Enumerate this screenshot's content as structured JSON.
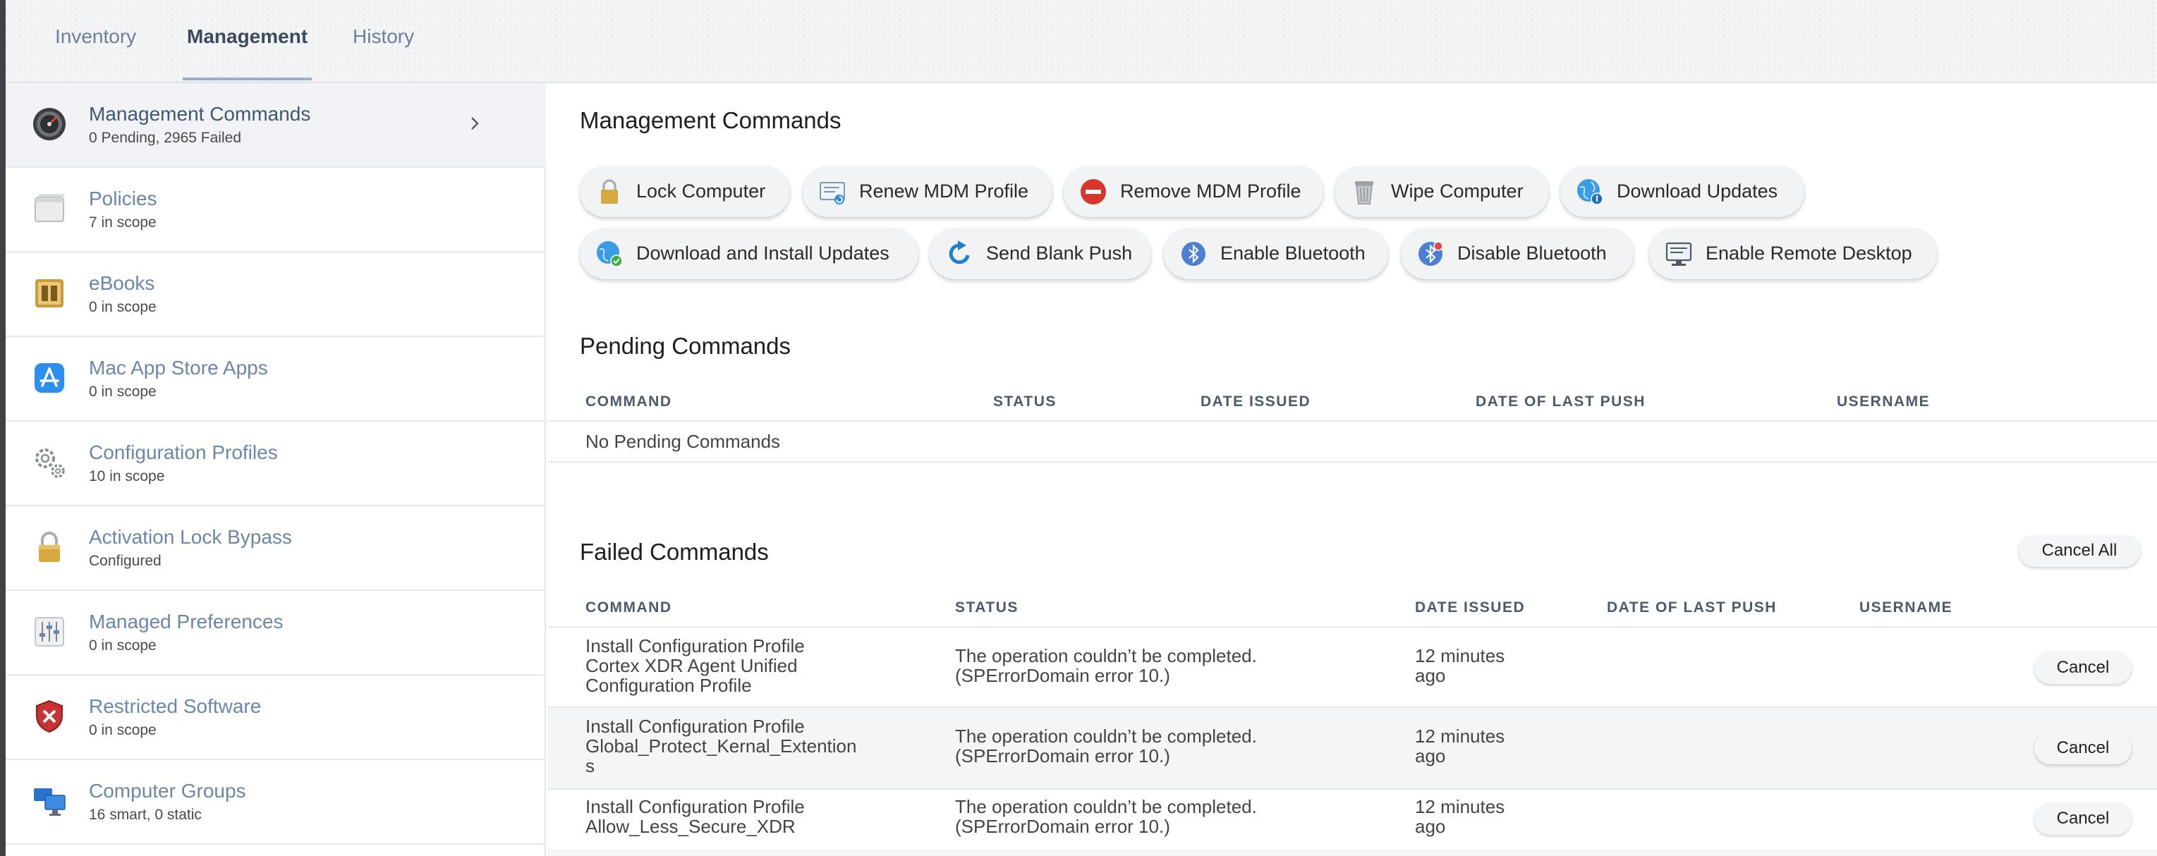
{
  "tabs": [
    {
      "label": "Inventory"
    },
    {
      "label": "Management"
    },
    {
      "label": "History"
    }
  ],
  "sidebar": {
    "items": [
      {
        "title": "Management Commands",
        "subtitle": "0 Pending, 2965 Failed",
        "icon": "gauge-icon"
      },
      {
        "title": "Policies",
        "subtitle": "7 in scope",
        "icon": "window-icon"
      },
      {
        "title": "eBooks",
        "subtitle": "0 in scope",
        "icon": "book-icon"
      },
      {
        "title": "Mac App Store Apps",
        "subtitle": "0 in scope",
        "icon": "app-store-icon"
      },
      {
        "title": "Configuration Profiles",
        "subtitle": "10 in scope",
        "icon": "gears-icon"
      },
      {
        "title": "Activation Lock Bypass",
        "subtitle": "Configured",
        "icon": "padlock-icon"
      },
      {
        "title": "Managed Preferences",
        "subtitle": "0 in scope",
        "icon": "sliders-icon"
      },
      {
        "title": "Restricted Software",
        "subtitle": "0 in scope",
        "icon": "shield-x-icon"
      },
      {
        "title": "Computer Groups",
        "subtitle": "16 smart, 0 static",
        "icon": "computers-icon"
      }
    ]
  },
  "management": {
    "title": "Management Commands",
    "buttons": [
      {
        "label": "Lock Computer",
        "icon": "padlock-icon"
      },
      {
        "label": "Renew MDM Profile",
        "icon": "certificate-renew-icon"
      },
      {
        "label": "Remove MDM Profile",
        "icon": "no-entry-icon"
      },
      {
        "label": "Wipe Computer",
        "icon": "trash-icon"
      },
      {
        "label": "Download Updates",
        "icon": "globe-download-icon"
      },
      {
        "label": "Download and Install Updates",
        "icon": "globe-check-icon"
      },
      {
        "label": "Send Blank Push",
        "icon": "refresh-arrow-icon"
      },
      {
        "label": "Enable Bluetooth",
        "icon": "bluetooth-icon"
      },
      {
        "label": "Disable Bluetooth",
        "icon": "bluetooth-off-icon"
      },
      {
        "label": "Enable Remote Desktop",
        "icon": "remote-desktop-icon"
      }
    ]
  },
  "pending": {
    "title": "Pending Commands",
    "columns": [
      "COMMAND",
      "STATUS",
      "DATE ISSUED",
      "DATE OF LAST PUSH",
      "USERNAME"
    ],
    "empty_text": "No Pending Commands"
  },
  "failed": {
    "title": "Failed Commands",
    "cancel_all_label": "Cancel All",
    "columns": [
      "COMMAND",
      "STATUS",
      "DATE ISSUED",
      "DATE OF LAST PUSH",
      "USERNAME"
    ],
    "rows": [
      {
        "command": [
          "Install Configuration Profile",
          "Cortex XDR Agent Unified",
          "Configuration Profile"
        ],
        "status": [
          "The operation couldn’t be completed.",
          "(SPErrorDomain error 10.)"
        ],
        "date_issued": [
          "12 minutes",
          "ago"
        ],
        "cancel_label": "Cancel"
      },
      {
        "command": [
          "Install Configuration Profile",
          "Global_Protect_Kernal_Extention",
          "s"
        ],
        "status": [
          "The operation couldn’t be completed.",
          "(SPErrorDomain error 10.)"
        ],
        "date_issued": [
          "12 minutes",
          "ago"
        ],
        "cancel_label": "Cancel"
      },
      {
        "command": [
          "Install Configuration Profile",
          "Allow_Less_Secure_XDR"
        ],
        "status": [
          "The operation couldn’t be completed.",
          "(SPErrorDomain error 10.)"
        ],
        "date_issued": [
          "12 minutes",
          "ago"
        ],
        "cancel_label": "Cancel"
      }
    ]
  },
  "colors": {
    "link_blue": "#6a86aa",
    "tab_underline": "#9ab0c8",
    "sidebar_active": "#f1f3f6"
  }
}
